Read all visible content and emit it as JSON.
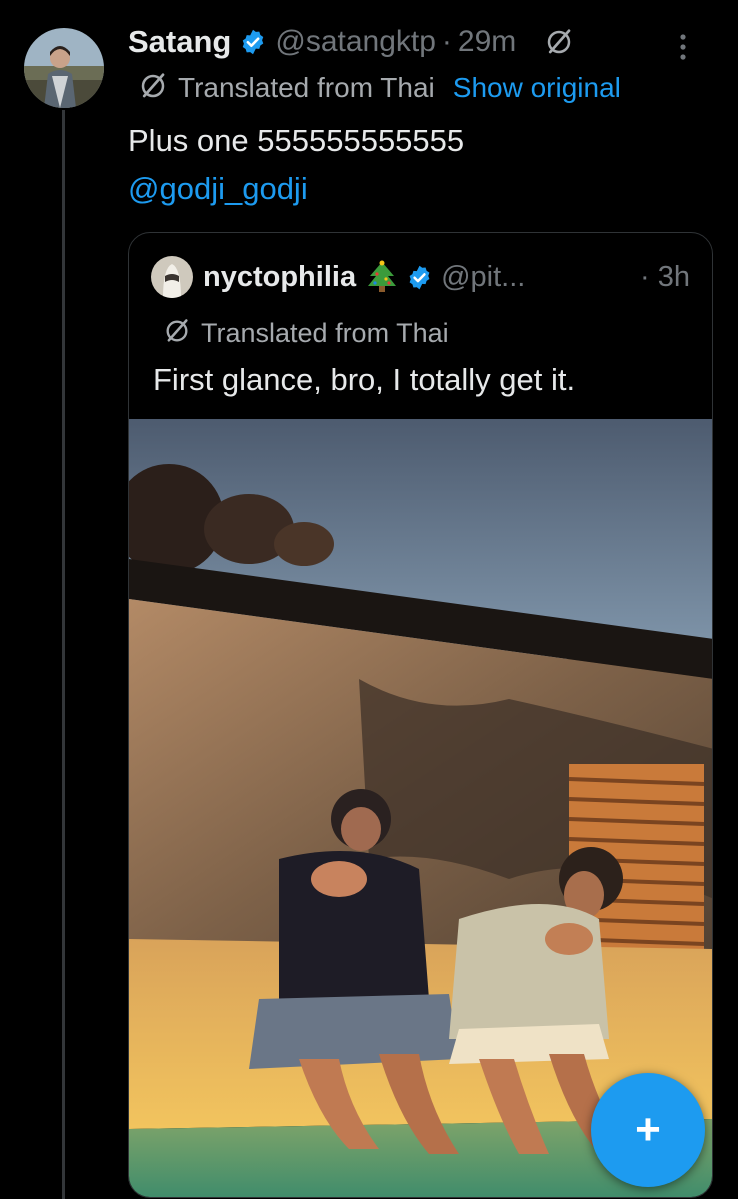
{
  "tweet": {
    "author_name": "Satang",
    "author_handle": "@satangktp",
    "separator": "·",
    "time": "29m",
    "translated_label": "Translated from Thai",
    "show_original_label": "Show original",
    "text": "Plus one 555555555555",
    "mention": "@godji_godji"
  },
  "quote": {
    "author_name": "nyctophilia",
    "author_handle": "@pit...",
    "time": "· 3h",
    "translated_label": "Translated from Thai",
    "text": "First glance, bro, I totally get it."
  },
  "fab": {
    "label": "+"
  },
  "icons": {
    "verified": "verified-badge-icon",
    "grok": "grok-translate-icon",
    "more": "more-vertical-icon",
    "tree": "christmas-tree-emoji",
    "compose": "plus-icon"
  },
  "colors": {
    "background": "#000000",
    "accent": "#1d9bf0",
    "text_primary": "#e7e9ea",
    "text_secondary": "#71767b"
  }
}
